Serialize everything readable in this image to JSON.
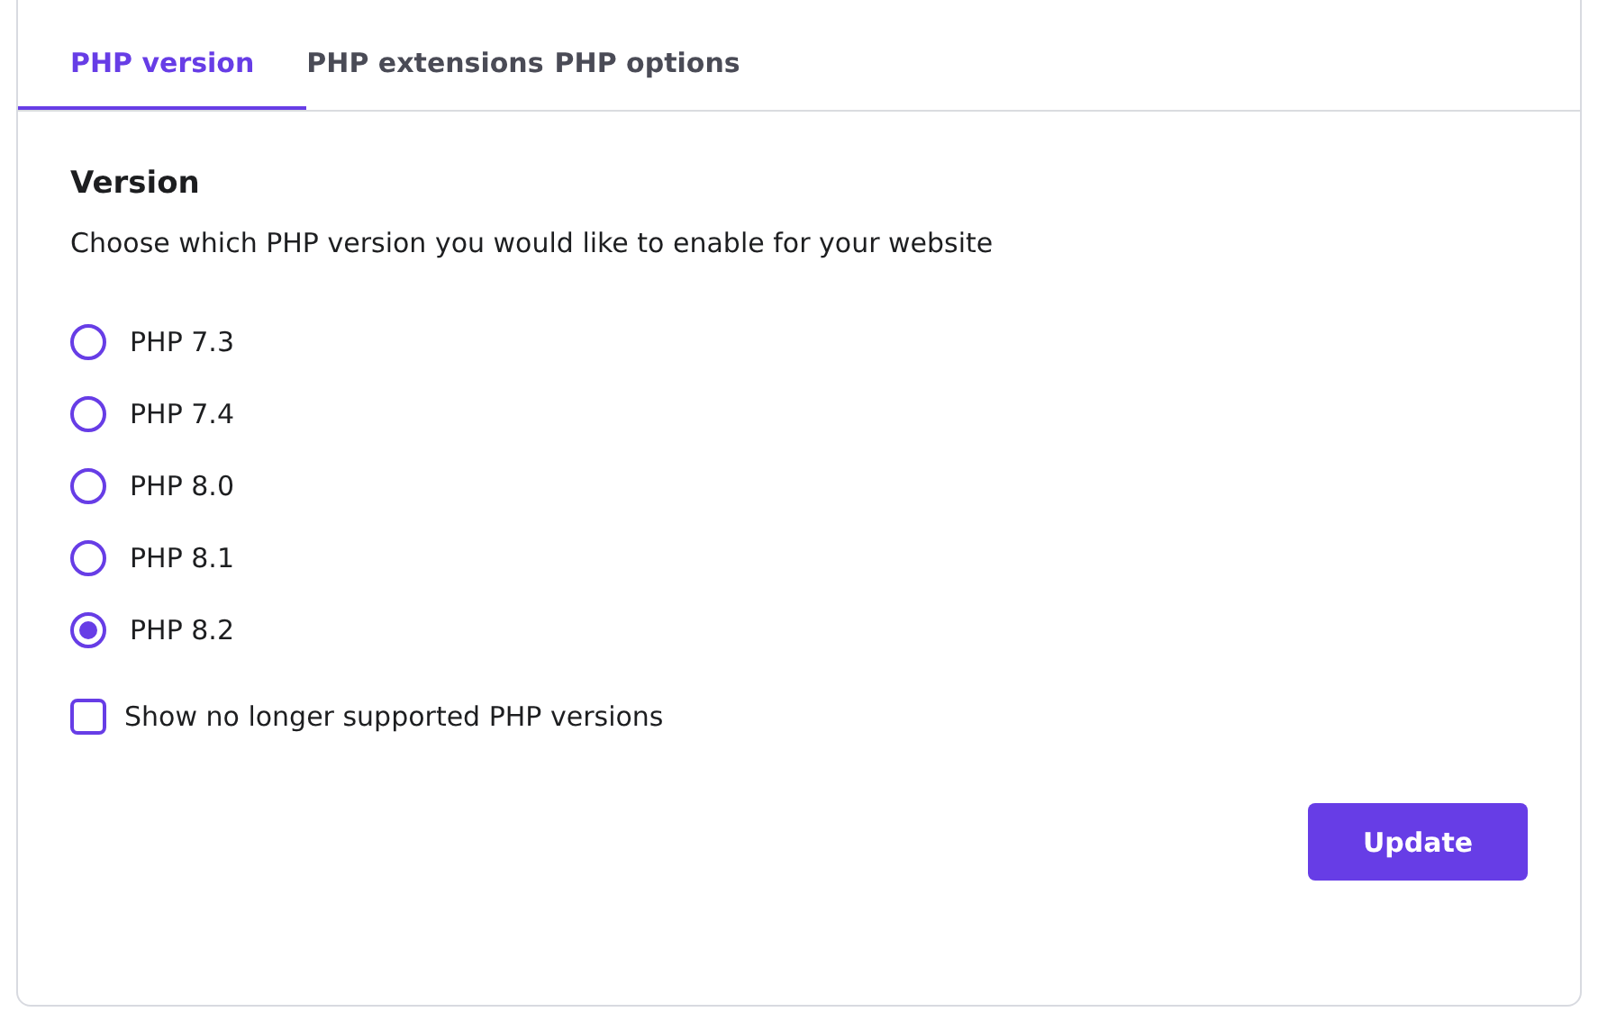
{
  "tabs": [
    {
      "label": "PHP version",
      "selected": true
    },
    {
      "label": "PHP extensions",
      "selected": false
    },
    {
      "label": "PHP options",
      "selected": false
    }
  ],
  "section": {
    "title": "Version",
    "description": "Choose which PHP version you would like to enable for your website"
  },
  "versions": [
    {
      "label": "PHP 7.3",
      "selected": false
    },
    {
      "label": "PHP 7.4",
      "selected": false
    },
    {
      "label": "PHP 8.0",
      "selected": false
    },
    {
      "label": "PHP 8.1",
      "selected": false
    },
    {
      "label": "PHP 8.2",
      "selected": true
    }
  ],
  "show_unsupported": {
    "label": "Show no longer supported PHP versions",
    "checked": false
  },
  "buttons": [
    {
      "label": "Update"
    }
  ]
}
